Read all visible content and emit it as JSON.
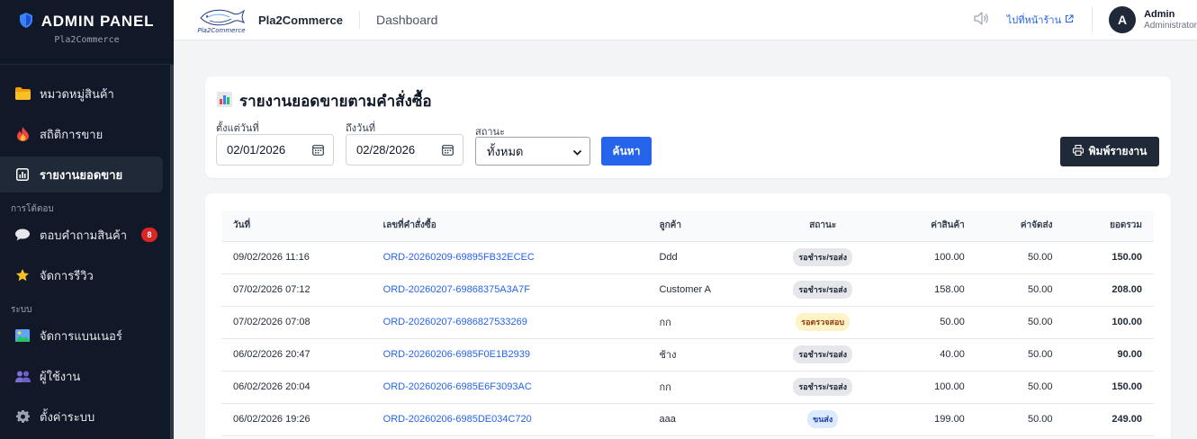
{
  "sidebar": {
    "title": "ADMIN PANEL",
    "subtitle": "Pla2Commerce",
    "items_top": [
      {
        "label": "หมวดหมู่สินค้า",
        "icon": "folder-icon",
        "color": "#f59e0b"
      },
      {
        "label": "สถิติการขาย",
        "icon": "fire-icon",
        "color": "#ef4444"
      },
      {
        "label": "รายงานยอดขาย",
        "icon": "chart-report-icon",
        "color": "#ffffff",
        "active": true
      }
    ],
    "section_interaction": "การโต้ตอบ",
    "items_interaction": [
      {
        "label": "ตอบคำถามสินค้า",
        "icon": "chat-bubble-icon",
        "badge": "8"
      },
      {
        "label": "จัดการรีวิว",
        "icon": "star-icon"
      }
    ],
    "section_system": "ระบบ",
    "items_system": [
      {
        "label": "จัดการแบนเนอร์",
        "icon": "image-icon"
      },
      {
        "label": "ผู้ใช้งาน",
        "icon": "users-icon"
      },
      {
        "label": "ตั้งค่าระบบ",
        "icon": "gear-icon"
      }
    ]
  },
  "topbar": {
    "logo_text": "Pla2Commerce",
    "store_name": "Pla2Commerce",
    "breadcrumb": "Dashboard",
    "shop_link": "ไปที่หน้าร้าน",
    "user_initial": "A",
    "user_name": "Admin",
    "user_role": "Administrator"
  },
  "filter": {
    "title": "รายงานยอดขายตามคำสั่งซื้อ",
    "from_label": "ตั้งแต่วันที่",
    "from_value": "02/01/2026",
    "to_label": "ถึงวันที่",
    "to_value": "02/28/2026",
    "status_label": "สถานะ",
    "status_value": "ทั้งหมด",
    "search_button": "ค้นหา",
    "print_button": "พิมพ์รายงาน"
  },
  "table": {
    "headers": {
      "date": "วันที่",
      "order": "เลขที่คำสั่งซื้อ",
      "customer": "ลูกค้า",
      "status": "สถานะ",
      "goods": "ค่าสินค้า",
      "shipping": "ค่าจัดส่ง",
      "total": "ยอดรวม"
    },
    "rows": [
      {
        "date": "09/02/2026 11:16",
        "order": "ORD-20260209-69895FB32ECEC",
        "customer": "Ddd",
        "status": "รอชำระ/รอส่ง",
        "status_style": "gray",
        "goods": "100.00",
        "shipping": "50.00",
        "total": "150.00"
      },
      {
        "date": "07/02/2026 07:12",
        "order": "ORD-20260207-69868375A3A7F",
        "customer": "Customer A",
        "status": "รอชำระ/รอส่ง",
        "status_style": "gray",
        "goods": "158.00",
        "shipping": "50.00",
        "total": "208.00"
      },
      {
        "date": "07/02/2026 07:08",
        "order": "ORD-20260207-6986827533269",
        "customer": "กก",
        "status": "รอตรวจสอบ",
        "status_style": "yellow",
        "goods": "50.00",
        "shipping": "50.00",
        "total": "100.00"
      },
      {
        "date": "06/02/2026 20:47",
        "order": "ORD-20260206-6985F0E1B2939",
        "customer": "ช้าง",
        "status": "รอชำระ/รอส่ง",
        "status_style": "gray",
        "goods": "40.00",
        "shipping": "50.00",
        "total": "90.00"
      },
      {
        "date": "06/02/2026 20:04",
        "order": "ORD-20260206-6985E6F3093AC",
        "customer": "กก",
        "status": "รอชำระ/รอส่ง",
        "status_style": "gray",
        "goods": "100.00",
        "shipping": "50.00",
        "total": "150.00"
      },
      {
        "date": "06/02/2026 19:26",
        "order": "ORD-20260206-6985DE034C720",
        "customer": "aaa",
        "status": "ขนส่ง",
        "status_style": "blue",
        "goods": "199.00",
        "shipping": "50.00",
        "total": "249.00"
      }
    ]
  }
}
